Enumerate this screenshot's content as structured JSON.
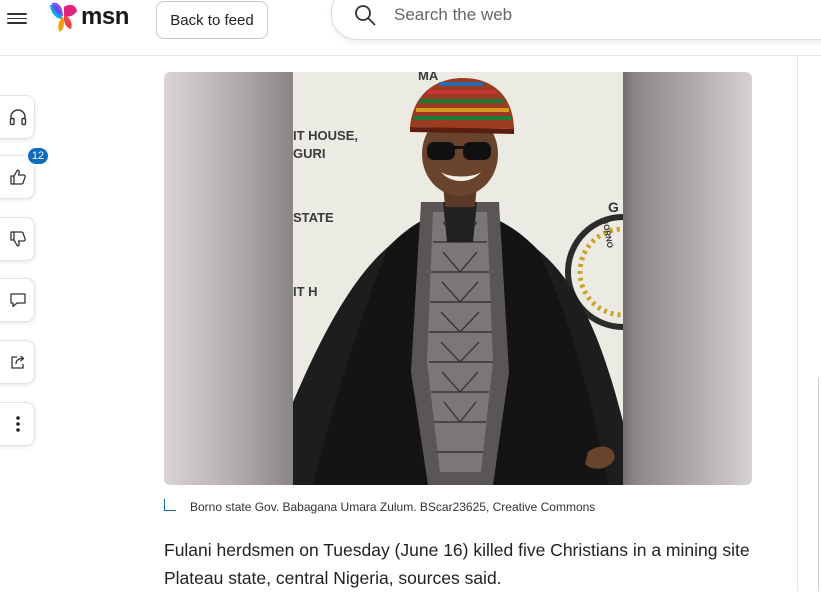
{
  "header": {
    "logo_text": "msn",
    "back_label": "Back to feed",
    "search_placeholder": "Search the web"
  },
  "rail": {
    "like_count": "12",
    "items": [
      "listen-icon",
      "thumbs-up-icon",
      "thumbs-down-icon",
      "comment-icon",
      "share-icon",
      "more-icon"
    ]
  },
  "article": {
    "photo_sign_lines": [
      "MA",
      "IT HOUSE,",
      "GURI",
      "STATE",
      "IT H",
      "G",
      "BORNO"
    ],
    "caption": "Borno state Gov. Babagana Umara Zulum. BScar23625, Creative Commons",
    "paragraph": "Fulani herdsmen on Tuesday (June 16) killed five Christians in a mining site Plateau state, central Nigeria, sources said."
  },
  "colors": {
    "accent": "#0f6cbd",
    "logo_pink": "#e2237d",
    "logo_blue": "#0ea5e9",
    "logo_purple": "#7c3aed",
    "logo_orange": "#f59e0b"
  }
}
